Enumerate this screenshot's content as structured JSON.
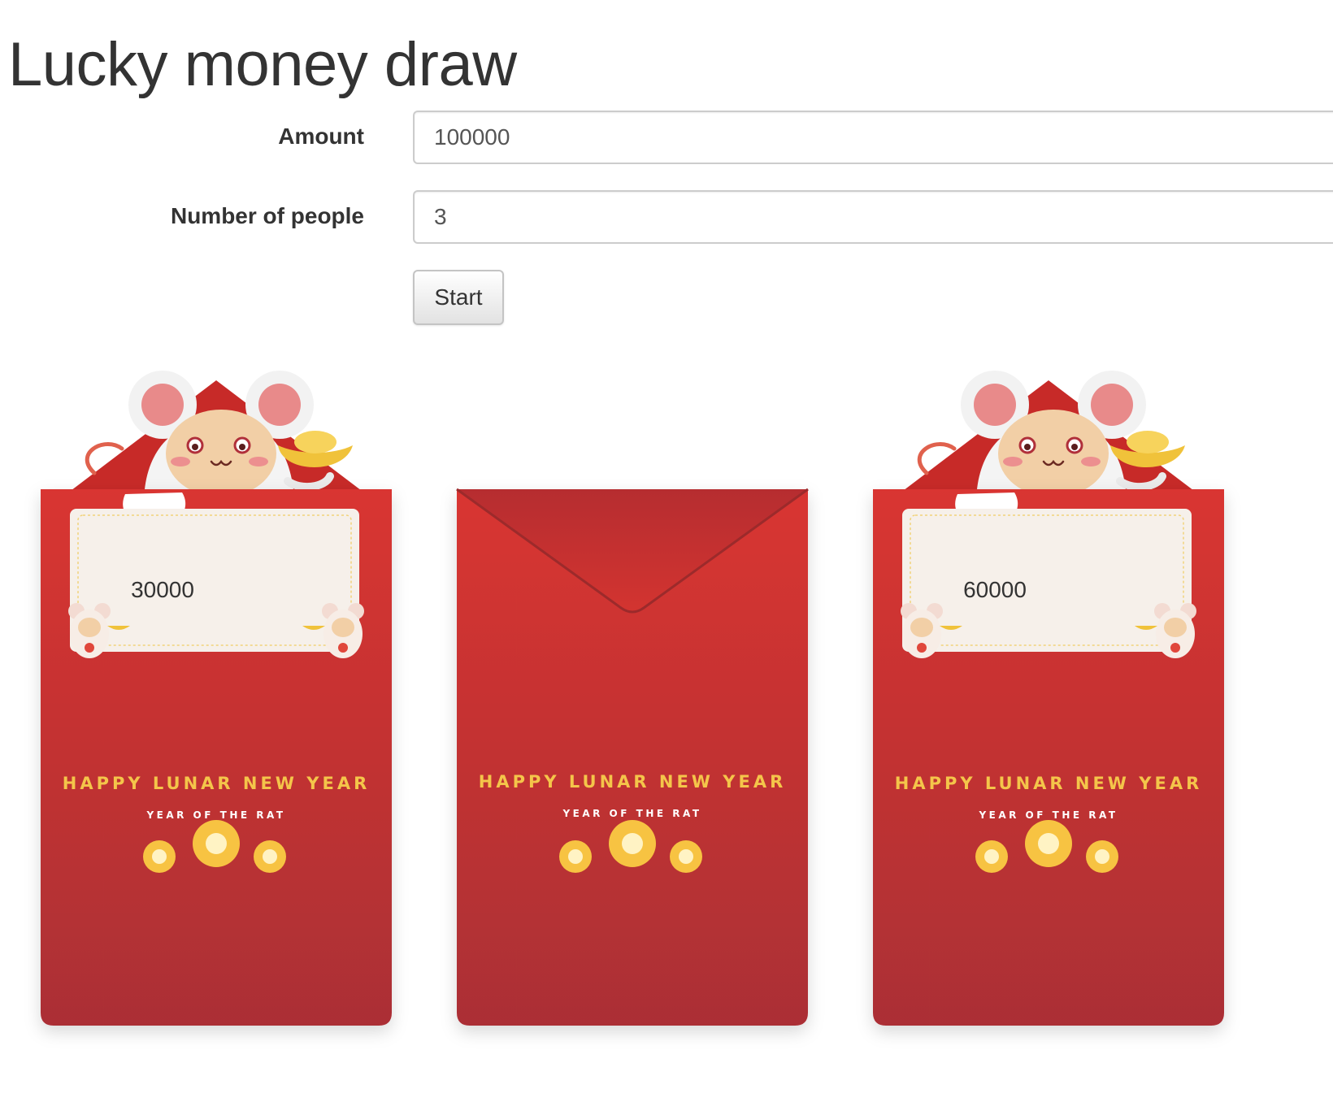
{
  "header": {
    "title": "Lucky money draw"
  },
  "form": {
    "amount_label": "Amount",
    "amount_value": "100000",
    "people_label": "Number of people",
    "people_value": "3",
    "start_label": "Start"
  },
  "envelopes": [
    {
      "state": "opened",
      "amount": "30000",
      "greeting": "HAPPY LUNAR NEW YEAR",
      "sub_greeting": "YEAR OF THE RAT"
    },
    {
      "state": "closed",
      "greeting": "HAPPY LUNAR NEW YEAR",
      "sub_greeting": "YEAR OF THE RAT"
    },
    {
      "state": "opened",
      "amount": "60000",
      "greeting": "HAPPY LUNAR NEW YEAR",
      "sub_greeting": "YEAR OF THE RAT"
    }
  ],
  "colors": {
    "envelope_red": "#c93330",
    "envelope_dark_red": "#a82a2e",
    "gold": "#f4c54a",
    "card": "#f6f0ea"
  },
  "icons": [
    "rat-mascot-icon",
    "gold-ingot-icon",
    "blossom-icon"
  ]
}
